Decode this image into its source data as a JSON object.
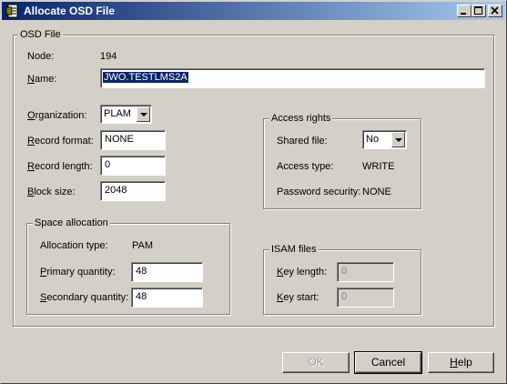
{
  "window": {
    "title": "Allocate OSD File"
  },
  "osd_file": {
    "group_label": "OSD File",
    "node_label": "Node:",
    "node_value": "194",
    "name_label": "Name:",
    "name_value": "JWO.TESTLMS2A",
    "organization_label": "Organization:",
    "organization_value": "PLAM",
    "record_format_label": "Record format:",
    "record_format_value": "NONE",
    "record_length_label": "Record length:",
    "record_length_value": "0",
    "block_size_label": "Block size:",
    "block_size_value": "2048"
  },
  "access_rights": {
    "group_label": "Access rights",
    "shared_file_label": "Shared file:",
    "shared_file_value": "No",
    "access_type_label": "Access type:",
    "access_type_value": "WRITE",
    "password_security_label": "Password security:",
    "password_security_value": "NONE"
  },
  "space_allocation": {
    "group_label": "Space allocation",
    "allocation_type_label": "Allocation type:",
    "allocation_type_value": "PAM",
    "primary_quantity_label": "Primary quantity:",
    "primary_quantity_value": "48",
    "secondary_quantity_label": "Secondary quantity:",
    "secondary_quantity_value": "48"
  },
  "isam_files": {
    "group_label": "ISAM files",
    "key_length_label": "Key length:",
    "key_length_value": "0",
    "key_start_label": "Key start:",
    "key_start_value": "0"
  },
  "buttons": {
    "ok": "OK",
    "cancel": "Cancel",
    "help": "Help"
  }
}
